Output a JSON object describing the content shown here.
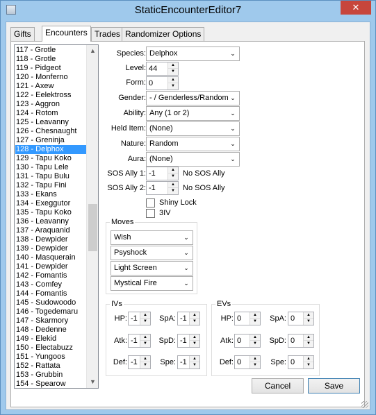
{
  "window": {
    "title": "StaticEncounterEditor7",
    "close_glyph": "✕"
  },
  "tabs": [
    "Gifts",
    "Encounters",
    "Trades",
    "Randomizer Options"
  ],
  "encounter_list": [
    "117 - Grotle",
    "118 - Grotle",
    "119 - Pidgeot",
    "120 - Monferno",
    "121 - Axew",
    "122 - Eelektross",
    "123 - Aggron",
    "124 - Rotom",
    "125 - Leavanny",
    "126 - Chesnaught",
    "127 - Greninja",
    "128 - Delphox",
    "129 - Tapu Koko",
    "130 - Tapu Lele",
    "131 - Tapu Bulu",
    "132 - Tapu Fini",
    "133 - Ekans",
    "134 - Exeggutor",
    "135 - Tapu Koko",
    "136 - Leavanny",
    "137 - Araquanid",
    "138 - Dewpider",
    "139 - Dewpider",
    "140 - Masquerain",
    "141 - Dewpider",
    "142 - Fomantis",
    "143 - Comfey",
    "144 - Fomantis",
    "145 - Sudowoodo",
    "146 - Togedemaru",
    "147 - Skarmory",
    "148 - Dedenne",
    "149 - Elekid",
    "150 - Electabuzz",
    "151 - Yungoos",
    "152 - Rattata",
    "153 - Grubbin",
    "154 - Spearow"
  ],
  "selected_index": 11,
  "scroll": {
    "up": "▲",
    "down": "▼"
  },
  "form": {
    "species": {
      "label": "Species:",
      "value": "Delphox"
    },
    "level": {
      "label": "Level:",
      "value": "44"
    },
    "form": {
      "label": "Form:",
      "value": "0"
    },
    "gender": {
      "label": "Gender:",
      "value": "- / Genderless/Random"
    },
    "ability": {
      "label": "Ability:",
      "value": "Any (1 or 2)"
    },
    "held_item": {
      "label": "Held Item:",
      "value": "(None)"
    },
    "nature": {
      "label": "Nature:",
      "value": "Random"
    },
    "aura": {
      "label": "Aura:",
      "value": "(None)"
    },
    "sos_ally_1": {
      "label": "SOS Ally 1:",
      "value": "-1",
      "text": "No SOS Ally"
    },
    "sos_ally_2": {
      "label": "SOS Ally 2:",
      "value": "-1",
      "text": "No SOS Ally"
    },
    "shiny_lock": {
      "label": "Shiny Lock",
      "checked": false
    },
    "three_iv": {
      "label": "3IV",
      "checked": false
    }
  },
  "moves": {
    "title": "Moves",
    "values": [
      "Wish",
      "Psyshock",
      "Light Screen",
      "Mystical Fire"
    ]
  },
  "ivs": {
    "title": "IVs",
    "hp": {
      "label": "HP:",
      "value": "-1"
    },
    "atk": {
      "label": "Atk:",
      "value": "-1"
    },
    "def": {
      "label": "Def:",
      "value": "-1"
    },
    "spa": {
      "label": "SpA:",
      "value": "-1"
    },
    "spd": {
      "label": "SpD:",
      "value": "-1"
    },
    "spe": {
      "label": "Spe:",
      "value": "-1"
    }
  },
  "evs": {
    "title": "EVs",
    "hp": {
      "label": "HP:",
      "value": "0"
    },
    "atk": {
      "label": "Atk:",
      "value": "0"
    },
    "def": {
      "label": "Def:",
      "value": "0"
    },
    "spa": {
      "label": "SpA:",
      "value": "0"
    },
    "spd": {
      "label": "SpD:",
      "value": "0"
    },
    "spe": {
      "label": "Spe:",
      "value": "0"
    }
  },
  "buttons": {
    "cancel": "Cancel",
    "save": "Save"
  },
  "glyphs": {
    "dropdown": "⌄",
    "spin_up": "▲",
    "spin_down": "▼"
  }
}
